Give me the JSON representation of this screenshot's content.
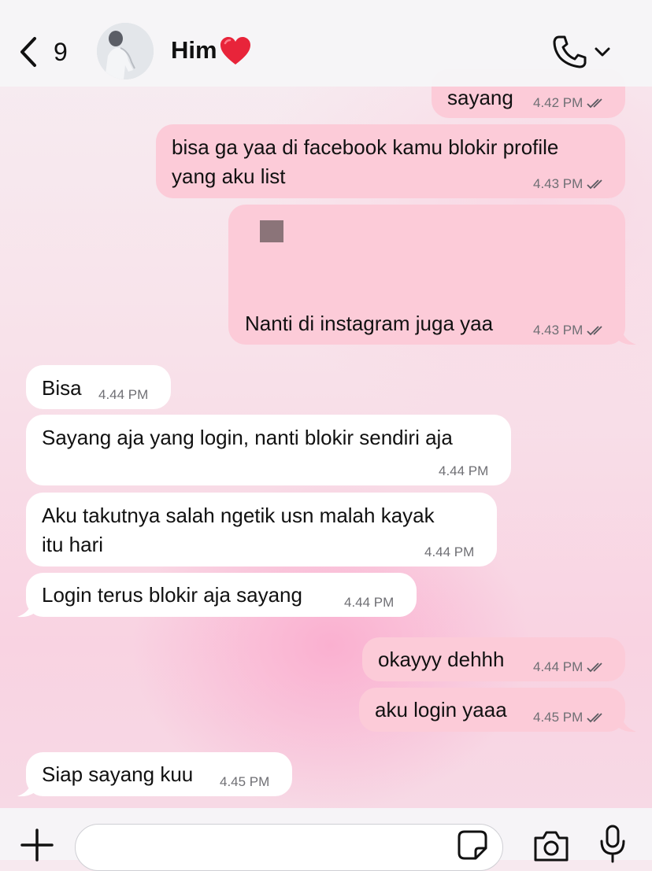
{
  "header": {
    "back_count": "9",
    "contact_name": "Him",
    "contact_emoji_icon": "red-heart-icon",
    "call_icon": "phone-icon",
    "call_menu_icon": "chevron-down-icon"
  },
  "messages": [
    {
      "dir": "out",
      "text_lines": [
        "sayang"
      ],
      "time": "4.42 PM",
      "read": true
    },
    {
      "dir": "out",
      "text_lines": [
        "bisa ga yaa di facebook kamu blokir profile",
        "yang aku list"
      ],
      "time": "4.43 PM",
      "read": true
    },
    {
      "dir": "out",
      "text_lines": [
        "Nanti di instagram juga yaa"
      ],
      "time": "4.43 PM",
      "read": true,
      "has_image": true
    },
    {
      "dir": "in",
      "text_lines": [
        "Bisa"
      ],
      "time": "4.44 PM"
    },
    {
      "dir": "in",
      "text_lines": [
        "Sayang aja yang login, nanti blokir sendiri aja"
      ],
      "time": "4.44 PM"
    },
    {
      "dir": "in",
      "text_lines": [
        "Aku takutnya salah ngetik usn malah kayak",
        "itu hari"
      ],
      "time": "4.44 PM"
    },
    {
      "dir": "in",
      "text_lines": [
        "Login terus blokir aja sayang"
      ],
      "time": "4.44 PM"
    },
    {
      "dir": "out",
      "text_lines": [
        "okayyy dehhh"
      ],
      "time": "4.44 PM",
      "read": true
    },
    {
      "dir": "out",
      "text_lines": [
        "aku login yaaa"
      ],
      "time": "4.45 PM",
      "read": true
    },
    {
      "dir": "in",
      "text_lines": [
        "Siap sayang kuu"
      ],
      "time": "4.45 PM"
    }
  ],
  "composer": {
    "text": "",
    "icons": [
      "plus-icon",
      "sticker-icon",
      "camera-icon",
      "microphone-icon"
    ]
  },
  "colors": {
    "outgoing_bubble": "#fccbd8",
    "incoming_bubble": "#ffffff",
    "read_ticks": "#5a5a60"
  }
}
